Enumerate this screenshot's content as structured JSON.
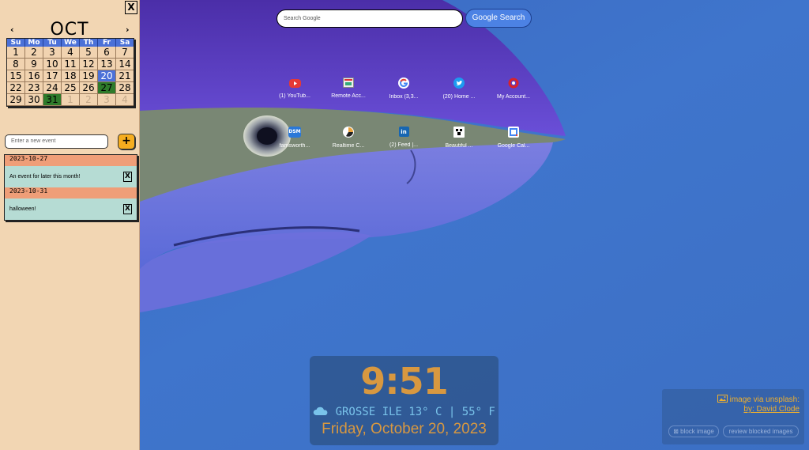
{
  "calendar": {
    "prev": "‹",
    "next": "›",
    "month_title": "OCT 2023",
    "weekdays": [
      "Su",
      "Mo",
      "Tu",
      "We",
      "Th",
      "Fr",
      "Sa"
    ],
    "weeks": [
      [
        "1",
        "2",
        "3",
        "4",
        "5",
        "6",
        "7"
      ],
      [
        "8",
        "9",
        "10",
        "11",
        "12",
        "13",
        "14"
      ],
      [
        "15",
        "16",
        "17",
        "18",
        "19",
        "20",
        "21"
      ],
      [
        "22",
        "23",
        "24",
        "25",
        "26",
        "27",
        "28"
      ],
      [
        "29",
        "30",
        "31",
        "1",
        "2",
        "3",
        "4"
      ]
    ],
    "today": "20",
    "event_days": [
      "27",
      "31"
    ]
  },
  "sidebar": {
    "close_label": "X",
    "event_input_placeholder": "Enter a new event",
    "add_label": "+",
    "events": [
      {
        "date": "2023-10-27",
        "text": "An event for later this month!",
        "delete_label": "X"
      },
      {
        "date": "2023-10-31",
        "text": "halloween!",
        "delete_label": "X"
      }
    ]
  },
  "search": {
    "placeholder": "Search Google",
    "button_label": "Google Search"
  },
  "shortcuts": [
    {
      "label": "(1) YouTub...",
      "icon": "youtube-icon"
    },
    {
      "label": "Remote Acc...",
      "icon": "remote-access-icon"
    },
    {
      "label": "Inbox (3,3...",
      "icon": "google-icon"
    },
    {
      "label": "(20) Home ...",
      "icon": "twitter-icon"
    },
    {
      "label": "My Account...",
      "icon": "account-icon"
    },
    {
      "label": "farnsworth...",
      "icon": "dsm-icon",
      "icon_text": "DSM"
    },
    {
      "label": "Realtime C...",
      "icon": "realtime-icon"
    },
    {
      "label": "(2) Feed |...",
      "icon": "linkedin-icon",
      "icon_text": "in"
    },
    {
      "label": "Beautiful ...",
      "icon": "beautiful-icon"
    },
    {
      "label": "Google Cal...",
      "icon": "calendar-icon"
    }
  ],
  "clock": {
    "time": "9:51",
    "weather": "GROSSE ILE 13° C | 55° F",
    "weather_icon": "cloud-icon",
    "date": "Friday, October 20, 2023"
  },
  "credit": {
    "line": "image via unsplash:",
    "author": "by: David Clode",
    "block_label": "block image",
    "review_label": "review blocked images"
  },
  "colors": {
    "sidebar_bg": "#f2d6b3",
    "accent_blue": "#4b71d8",
    "event_green": "#2e7b2b",
    "event_date_bg": "#ef9e78",
    "event_item_bg": "#b6dcd4",
    "clock_orange": "#d89840"
  }
}
